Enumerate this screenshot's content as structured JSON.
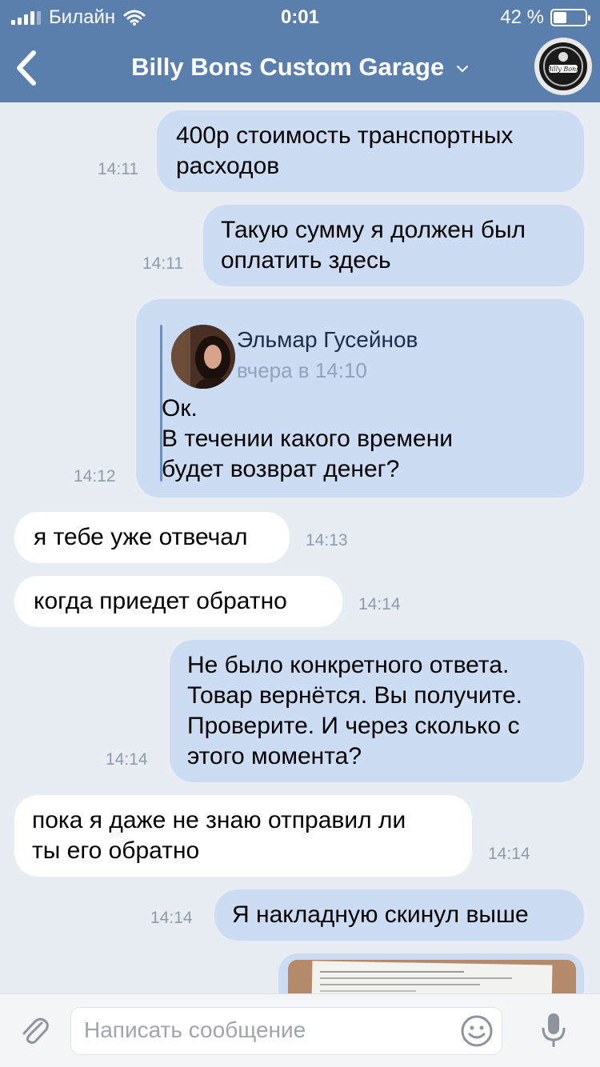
{
  "status_bar": {
    "carrier": "Билайн",
    "time": "0:01",
    "battery": "42 %",
    "battery_level": 0.42
  },
  "header": {
    "title": "Billy Bons Custom Garage",
    "avatar_text": "Billy Bons"
  },
  "messages": [
    {
      "direction": "out",
      "lines": [
        "400р стоимость транспортных",
        "расходов"
      ],
      "time": "14:11"
    },
    {
      "direction": "out",
      "lines": [
        "Такую сумму я должен был",
        "оплатить здесь"
      ],
      "time": "14:11"
    },
    {
      "direction": "out",
      "forwarded": {
        "author": "Эльмар Гусейнов",
        "date": "вчера в 14:10",
        "lines": [
          "Ок.",
          "В течении какого времени",
          "будет возврат денег?"
        ]
      },
      "time": "14:12"
    },
    {
      "direction": "in",
      "lines": [
        "я тебе уже отвечал"
      ],
      "time": "14:13"
    },
    {
      "direction": "in",
      "lines": [
        "когда приедет обратно"
      ],
      "time": "14:14"
    },
    {
      "direction": "out",
      "lines": [
        "Не было конкретного ответа.",
        "Товар вернётся. Вы получите.",
        "Проверите. И через сколько с",
        "этого момента?"
      ],
      "time": "14:14"
    },
    {
      "direction": "in",
      "lines": [
        "пока я даже не знаю отправил ли",
        "ты его обратно"
      ],
      "time": "14:14"
    },
    {
      "direction": "out",
      "lines": [
        "Я накладную скинул выше"
      ],
      "time": "14:14"
    }
  ],
  "input": {
    "placeholder": "Написать сообщение"
  },
  "colors": {
    "header": "#5b7fad",
    "outgoing": "#ccdcf3",
    "incoming": "#ffffff",
    "background": "#e8edf3"
  }
}
